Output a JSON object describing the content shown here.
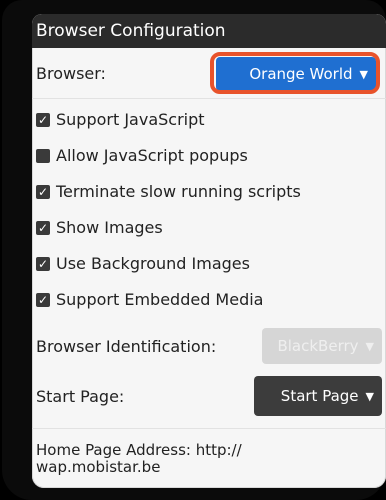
{
  "title": "Browser Configuration",
  "browser_row": {
    "label": "Browser:",
    "value": "Orange World"
  },
  "checkboxes": [
    {
      "label": "Support JavaScript",
      "checked": true
    },
    {
      "label": "Allow JavaScript popups",
      "checked": false
    },
    {
      "label": "Terminate slow running scripts",
      "checked": true
    },
    {
      "label": "Show Images",
      "checked": true
    },
    {
      "label": "Use Background Images",
      "checked": true
    },
    {
      "label": "Support Embedded Media",
      "checked": true
    }
  ],
  "browser_identification": {
    "label": "Browser Identification:",
    "value": "BlackBerry",
    "enabled": false
  },
  "start_page": {
    "label": "Start Page:",
    "value": "Start Page"
  },
  "home_page": {
    "label": "Home Page Address: http://",
    "url": "wap.mobistar.be"
  },
  "icons": {
    "caret": "chevron-down-icon",
    "check": "checkmark-icon"
  },
  "colors": {
    "dropdown_blue": "#1f6fd1",
    "highlight": "#e8532b",
    "title_bar": "#2b2b2b"
  }
}
